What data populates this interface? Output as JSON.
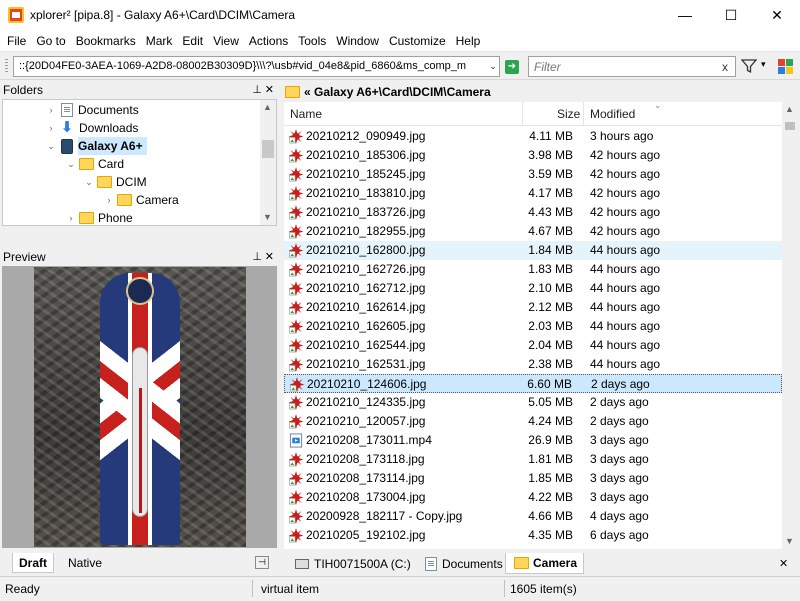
{
  "window": {
    "title": "xplorer² [pipa.8] - Galaxy A6+\\Card\\DCIM\\Camera",
    "minimize": "—",
    "maximize": "☐",
    "close": "✕"
  },
  "menu": [
    "File",
    "Go to",
    "Bookmarks",
    "Mark",
    "Edit",
    "View",
    "Actions",
    "Tools",
    "Window",
    "Customize",
    "Help"
  ],
  "address": {
    "value": "::{20D04FE0-3AEA-1069-A2D8-08002B30309D}\\\\\\?\\usb#vid_04e8&pid_6860&ms_comp_m",
    "dropdown": "⌄",
    "go": "➜"
  },
  "filter": {
    "placeholder": "Filter",
    "clear": "x"
  },
  "folders_pane": {
    "title": "Folders",
    "pin": "⊥",
    "close": "✕",
    "tree": [
      {
        "label": "Documents",
        "expander": "›",
        "kind": "doc"
      },
      {
        "label": "Downloads",
        "expander": "›",
        "kind": "download"
      },
      {
        "label": "Galaxy A6+",
        "expander": "⌄",
        "kind": "phone"
      },
      {
        "label": "Card",
        "expander": "⌄",
        "kind": "folder"
      },
      {
        "label": "DCIM",
        "expander": "⌄",
        "kind": "folder"
      },
      {
        "label": "Camera",
        "expander": "›",
        "kind": "folder"
      },
      {
        "label": "Phone",
        "expander": "›",
        "kind": "folder"
      }
    ]
  },
  "preview_pane": {
    "title": "Preview",
    "pin": "⊥",
    "close": "✕"
  },
  "left_tabs": [
    "Draft",
    "Native"
  ],
  "left_tab_button": "⊣",
  "breadcrumb": "« Galaxy A6+\\Card\\DCIM\\Camera",
  "columns": {
    "name": "Name",
    "size": "Size",
    "modified": "Modified"
  },
  "files": [
    {
      "name": "20210212_090949.jpg",
      "size": "4.11 MB",
      "modified": "3 hours ago",
      "type": "jpg"
    },
    {
      "name": "20210210_185306.jpg",
      "size": "3.98 MB",
      "modified": "42 hours ago",
      "type": "jpg"
    },
    {
      "name": "20210210_185245.jpg",
      "size": "3.59 MB",
      "modified": "42 hours ago",
      "type": "jpg"
    },
    {
      "name": "20210210_183810.jpg",
      "size": "4.17 MB",
      "modified": "42 hours ago",
      "type": "jpg"
    },
    {
      "name": "20210210_183726.jpg",
      "size": "4.43 MB",
      "modified": "42 hours ago",
      "type": "jpg"
    },
    {
      "name": "20210210_182955.jpg",
      "size": "4.67 MB",
      "modified": "42 hours ago",
      "type": "jpg"
    },
    {
      "name": "20210210_162800.jpg",
      "size": "1.84 MB",
      "modified": "44 hours ago",
      "type": "jpg"
    },
    {
      "name": "20210210_162726.jpg",
      "size": "1.83 MB",
      "modified": "44 hours ago",
      "type": "jpg"
    },
    {
      "name": "20210210_162712.jpg",
      "size": "2.10 MB",
      "modified": "44 hours ago",
      "type": "jpg"
    },
    {
      "name": "20210210_162614.jpg",
      "size": "2.12 MB",
      "modified": "44 hours ago",
      "type": "jpg"
    },
    {
      "name": "20210210_162605.jpg",
      "size": "2.03 MB",
      "modified": "44 hours ago",
      "type": "jpg"
    },
    {
      "name": "20210210_162544.jpg",
      "size": "2.04 MB",
      "modified": "44 hours ago",
      "type": "jpg"
    },
    {
      "name": "20210210_162531.jpg",
      "size": "2.38 MB",
      "modified": "44 hours ago",
      "type": "jpg"
    },
    {
      "name": "20210210_124606.jpg",
      "size": "6.60 MB",
      "modified": "2 days ago",
      "type": "jpg"
    },
    {
      "name": "20210210_124335.jpg",
      "size": "5.05 MB",
      "modified": "2 days ago",
      "type": "jpg"
    },
    {
      "name": "20210210_120057.jpg",
      "size": "4.24 MB",
      "modified": "2 days ago",
      "type": "jpg"
    },
    {
      "name": "20210208_173011.mp4",
      "size": "26.9 MB",
      "modified": "3 days ago",
      "type": "mp4"
    },
    {
      "name": "20210208_173118.jpg",
      "size": "1.81 MB",
      "modified": "3 days ago",
      "type": "jpg"
    },
    {
      "name": "20210208_173114.jpg",
      "size": "1.85 MB",
      "modified": "3 days ago",
      "type": "jpg"
    },
    {
      "name": "20210208_173004.jpg",
      "size": "4.22 MB",
      "modified": "3 days ago",
      "type": "jpg"
    },
    {
      "name": "20200928_182117 - Copy.jpg",
      "size": "4.66 MB",
      "modified": "4 days ago",
      "type": "jpg"
    },
    {
      "name": "20210205_192102.jpg",
      "size": "4.35 MB",
      "modified": "6 days ago",
      "type": "jpg"
    }
  ],
  "hover_row": 6,
  "selected_row": 13,
  "right_tabs": [
    "TIH0071500A (C:)",
    "Documents",
    "Camera"
  ],
  "right_tab_close": "✕",
  "status": {
    "left": "Ready",
    "middle": "virtual item",
    "right": "1605 item(s)"
  },
  "colors": {
    "accent_selected": "#cce8ff",
    "hover": "#e5f3fb",
    "folder": "#ffd55a",
    "go_button": "#2da44e",
    "jpg_icon": "#c8201c"
  }
}
